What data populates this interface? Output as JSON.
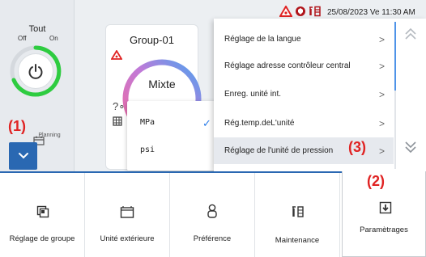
{
  "status": {
    "datetime": "25/08/2023 Ve 11:30 AM",
    "icons": [
      "warning-icon",
      "shield-icon",
      "maintenance-icon"
    ]
  },
  "left": {
    "all_label": "Tout",
    "off_label": "Off",
    "on_label": "On",
    "schedule_label": "Planning"
  },
  "group": {
    "name": "Group-01",
    "mode": "Mixte"
  },
  "unit_dropdown": {
    "options": [
      "MPa",
      "psi"
    ],
    "selected": "MPa"
  },
  "settings_menu": {
    "items": [
      "Réglage de la langue",
      "Réglage adresse contrôleur central",
      "Enreg. unité int.",
      "Rég.temp.deL'unité",
      "Réglage de l'unité de pression"
    ],
    "selected_index": 4
  },
  "callouts": [
    "(1)",
    "(2)",
    "(3)"
  ],
  "bottom_tabs": [
    {
      "label": "Réglage de groupe",
      "icon": "group-setting-icon"
    },
    {
      "label": "Unité extérieure",
      "icon": "outdoor-unit-icon"
    },
    {
      "label": "Préférence",
      "icon": "preference-icon"
    },
    {
      "label": "Maintenance",
      "icon": "maintenance-icon"
    },
    {
      "label": "Paramètrages",
      "icon": "download-icon"
    }
  ],
  "colors": {
    "accent": "#2a68b2",
    "callout": "#e02323",
    "check": "#2b7de9",
    "power_on": "#2ecc40",
    "warning": "#e02323"
  }
}
